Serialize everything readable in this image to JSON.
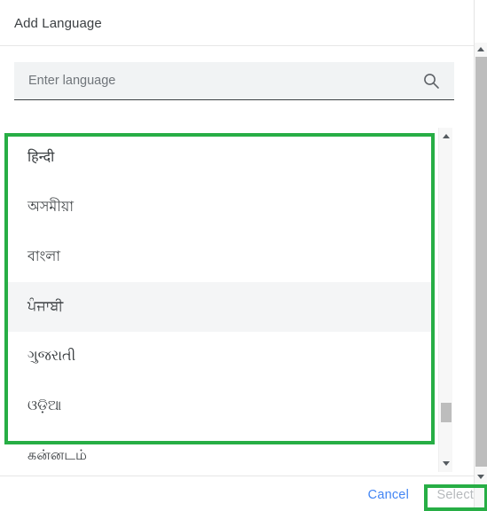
{
  "dialog": {
    "title": "Add Language"
  },
  "search": {
    "placeholder": "Enter language",
    "value": "",
    "icon": "search-icon"
  },
  "language_list": {
    "items": [
      {
        "label": "हिन्दी",
        "highlighted": false
      },
      {
        "label": "অসমীয়া",
        "highlighted": false
      },
      {
        "label": "বাংলা",
        "highlighted": false
      },
      {
        "label": "ਪੰਜਾਬੀ",
        "highlighted": true
      },
      {
        "label": "ગુજરાતી",
        "highlighted": false
      },
      {
        "label": "ଓଡ଼ିଆ",
        "highlighted": false
      },
      {
        "label": "கன்னடம்",
        "highlighted": false
      }
    ]
  },
  "footer": {
    "cancel_label": "Cancel",
    "select_label": "Select",
    "select_disabled": true
  },
  "scrollbars": {
    "inner_up_icon": "triangle-up-icon",
    "inner_down_icon": "triangle-down-icon",
    "outer_up_icon": "triangle-up-icon",
    "outer_down_icon": "triangle-down-icon"
  },
  "annotations": {
    "highlight_color": "#27ae45",
    "list_box": "language-list-highlight",
    "select_box": "select-button-highlight"
  },
  "colors": {
    "accent_link": "#4285f4",
    "text_primary": "#3c4043",
    "text_muted": "#70757a",
    "disabled": "#b6b9bc",
    "field_bg": "#f1f3f4",
    "row_hover_bg": "#f4f5f6",
    "highlight_green": "#27ae45"
  }
}
